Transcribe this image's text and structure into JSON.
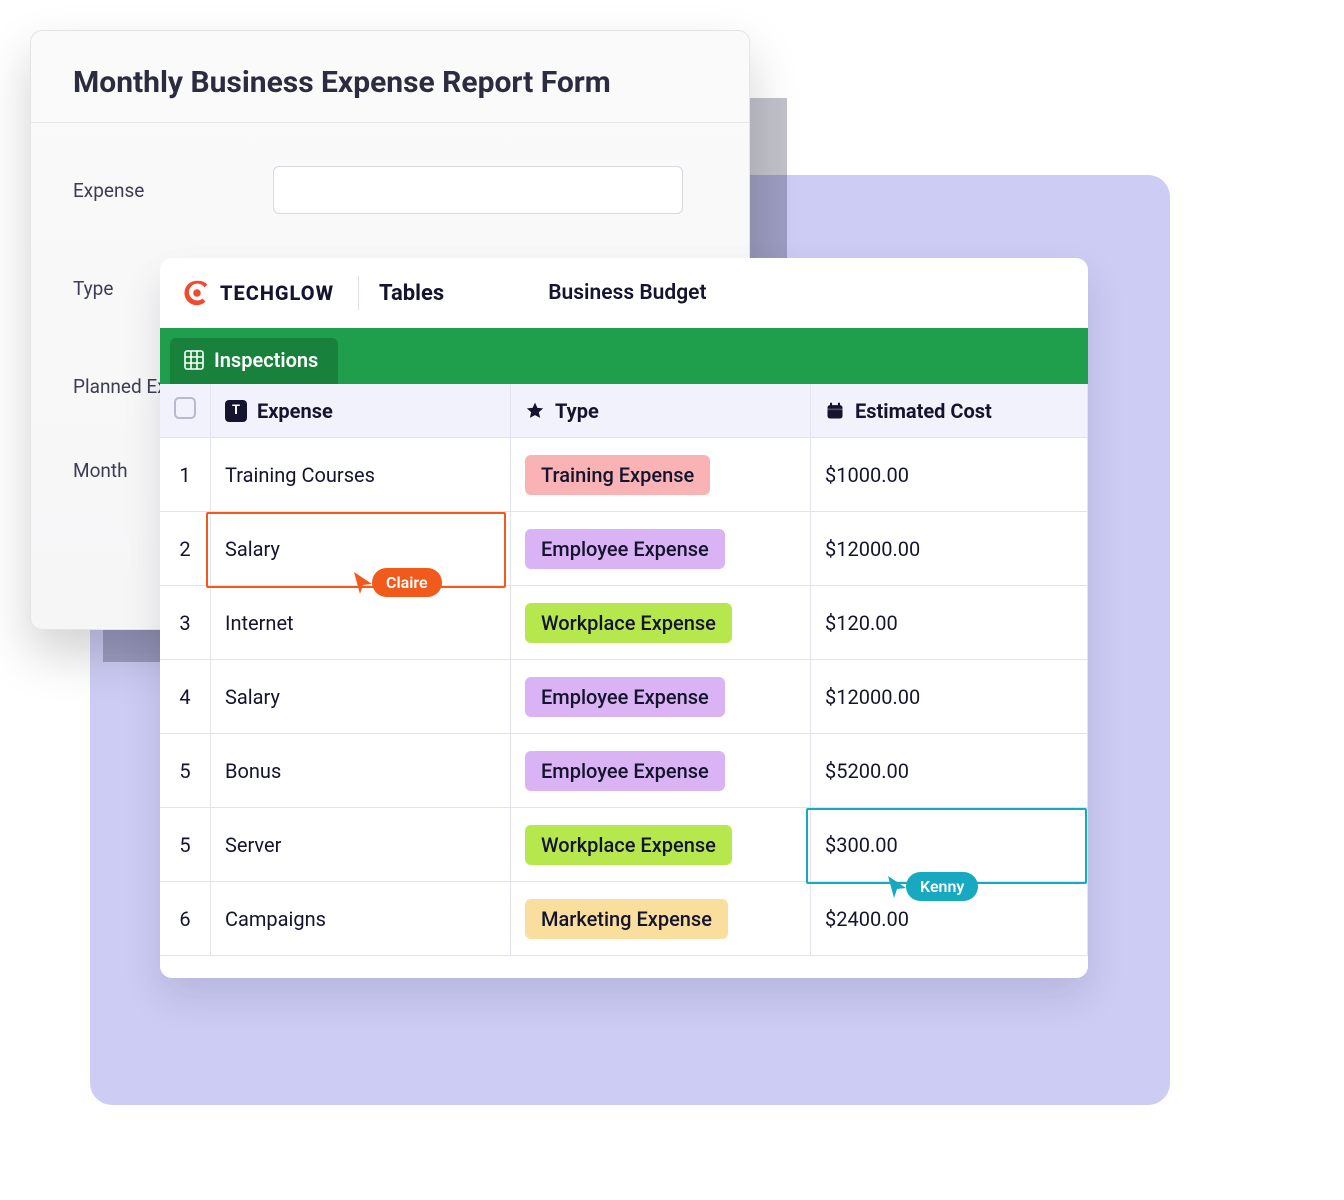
{
  "form": {
    "title": "Monthly Business Expense Report Form",
    "fields": [
      "Expense",
      "Type",
      "Planned Ex",
      "Month"
    ]
  },
  "app": {
    "brand": "TECHGLOW",
    "section": "Tables",
    "document": "Business Budget",
    "tab": "Inspections"
  },
  "table": {
    "columns": [
      "Expense",
      "Type",
      "Estimated Cost"
    ],
    "rows": [
      {
        "idx": "1",
        "expense": "Training Courses",
        "type": "Training Expense",
        "type_class": "training",
        "cost": "$1000.00"
      },
      {
        "idx": "2",
        "expense": "Salary",
        "type": "Employee Expense",
        "type_class": "employee",
        "cost": "$12000.00"
      },
      {
        "idx": "3",
        "expense": "Internet",
        "type": "Workplace Expense",
        "type_class": "workplace",
        "cost": "$120.00"
      },
      {
        "idx": "4",
        "expense": "Salary",
        "type": "Employee Expense",
        "type_class": "employee",
        "cost": "$12000.00"
      },
      {
        "idx": "5",
        "expense": "Bonus",
        "type": "Employee Expense",
        "type_class": "employee",
        "cost": "$5200.00"
      },
      {
        "idx": "5",
        "expense": "Server",
        "type": "Workplace Expense",
        "type_class": "workplace",
        "cost": "$300.00"
      },
      {
        "idx": "6",
        "expense": "Campaigns",
        "type": "Marketing Expense",
        "type_class": "marketing",
        "cost": "$2400.00"
      }
    ]
  },
  "cursors": {
    "orange": "Claire",
    "teal": "Kenny"
  }
}
